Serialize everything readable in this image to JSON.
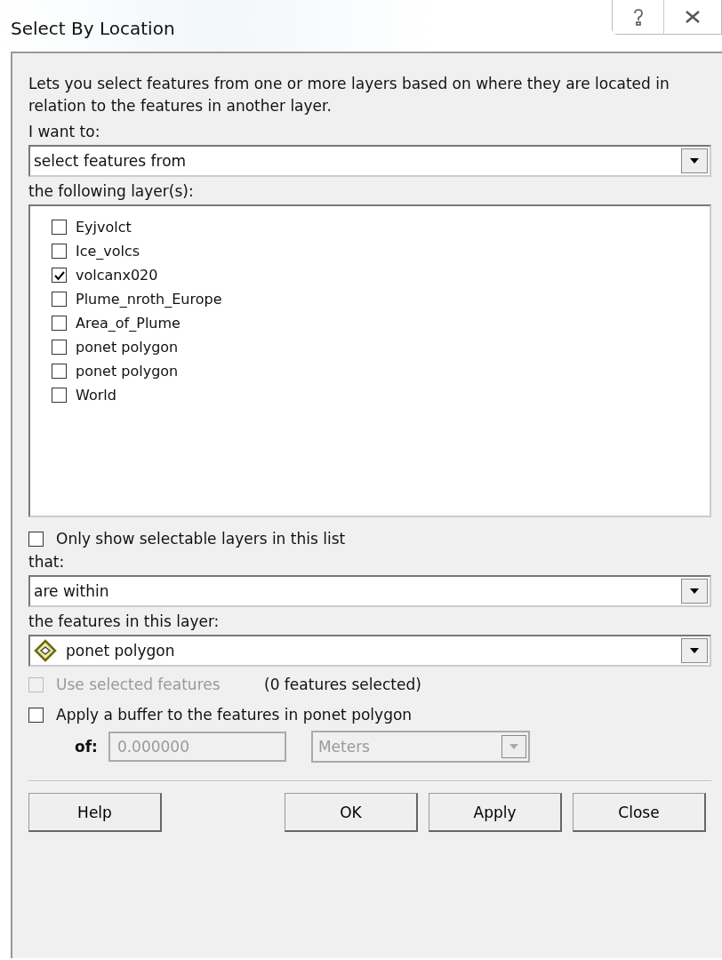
{
  "window": {
    "title": "Select By Location"
  },
  "description": "Lets you select features from one or more layers based on where they are located in relation to the features in another layer.",
  "want": {
    "label": "I want to:",
    "value": "select features from"
  },
  "layers": {
    "label": "the following layer(s):",
    "items": [
      {
        "name": "Eyjvolct",
        "checked": false
      },
      {
        "name": "Ice_volcs",
        "checked": false
      },
      {
        "name": "volcanx020",
        "checked": true
      },
      {
        "name": "Plume_nroth_Europe",
        "checked": false
      },
      {
        "name": "Area_of_Plume",
        "checked": false
      },
      {
        "name": "ponet polygon",
        "checked": false
      },
      {
        "name": "ponet polygon",
        "checked": false
      },
      {
        "name": "World",
        "checked": false
      }
    ]
  },
  "only_selectable": {
    "label": "Only show selectable layers in this list",
    "checked": false
  },
  "relation": {
    "label": "that:",
    "value": "are within"
  },
  "source": {
    "label": "the features in this layer:",
    "value": "ponet polygon"
  },
  "use_selected": {
    "label": "Use selected features",
    "checked": false,
    "disabled": true
  },
  "selected_count": "(0 features selected)",
  "buffer": {
    "label": "Apply a buffer to the features in ponet polygon",
    "checked": false,
    "of_label": "of:",
    "distance": "0.000000",
    "unit": "Meters",
    "disabled": true
  },
  "buttons": [
    "Help",
    "OK",
    "Apply",
    "Close"
  ]
}
